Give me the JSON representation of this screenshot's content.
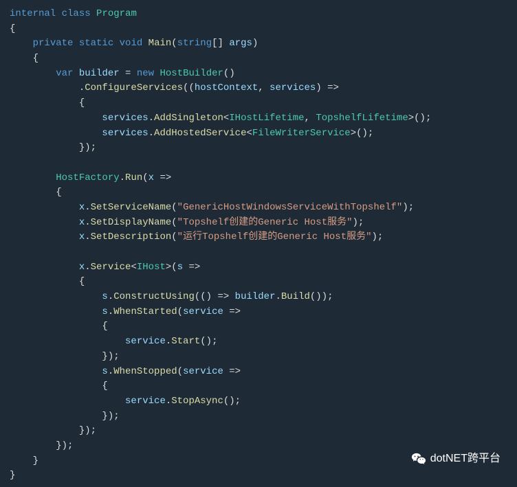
{
  "code": {
    "l1_internal": "internal",
    "l1_class": "class",
    "l1_program": "Program",
    "l2_brace": "{",
    "l3_private": "private",
    "l3_static": "static",
    "l3_void": "void",
    "l3_main": "Main",
    "l3_string": "string",
    "l3_brackets": "[]",
    "l3_args": "args",
    "l4_brace": "    {",
    "l5_var": "var",
    "l5_builder": "builder",
    "l5_eq": " = ",
    "l5_new": "new",
    "l5_hostbuilder": "HostBuilder",
    "l6_configservices": "ConfigureServices",
    "l6_hostcontext": "hostContext",
    "l6_services": "services",
    "l7_brace": "            {",
    "l8_services": "services",
    "l8_addsingleton": "AddSingleton",
    "l8_ihostlifetime": "IHostLifetime",
    "l8_topshelflifetime": "TopshelfLifetime",
    "l9_services": "services",
    "l9_addhosted": "AddHostedService",
    "l9_filewriter": "FileWriterService",
    "l10_close": "            });",
    "l12_hostfactory": "HostFactory",
    "l12_run": "Run",
    "l12_x": "x",
    "l13_brace": "        {",
    "l14_x": "x",
    "l14_setservicename": "SetServiceName",
    "l14_str": "\"GenericHostWindowsServiceWithTopshelf\"",
    "l15_x": "x",
    "l15_setdisplayname": "SetDisplayName",
    "l15_str": "\"Topshelf创建的Generic Host服务\"",
    "l16_x": "x",
    "l16_setdescription": "SetDescription",
    "l16_str": "\"运行Topshelf创建的Generic Host服务\"",
    "l18_x": "x",
    "l18_service": "Service",
    "l18_ihost": "IHost",
    "l18_s": "s",
    "l19_brace": "            {",
    "l20_s": "s",
    "l20_constructusing": "ConstructUsing",
    "l20_builder": "builder",
    "l20_build": "Build",
    "l21_s": "s",
    "l21_whenstarted": "WhenStarted",
    "l21_service": "service",
    "l22_brace": "                {",
    "l23_service": "service",
    "l23_start": "Start",
    "l24_close": "                });",
    "l25_s": "s",
    "l25_whenstopped": "WhenStopped",
    "l25_service": "service",
    "l26_brace": "                {",
    "l27_service": "service",
    "l27_stopasync": "StopAsync",
    "l28_close": "                });",
    "l29_close": "            });",
    "l30_close": "        });",
    "l31_brace": "    }",
    "l32_brace": "}"
  },
  "watermark": {
    "text": "dotNET跨平台"
  }
}
